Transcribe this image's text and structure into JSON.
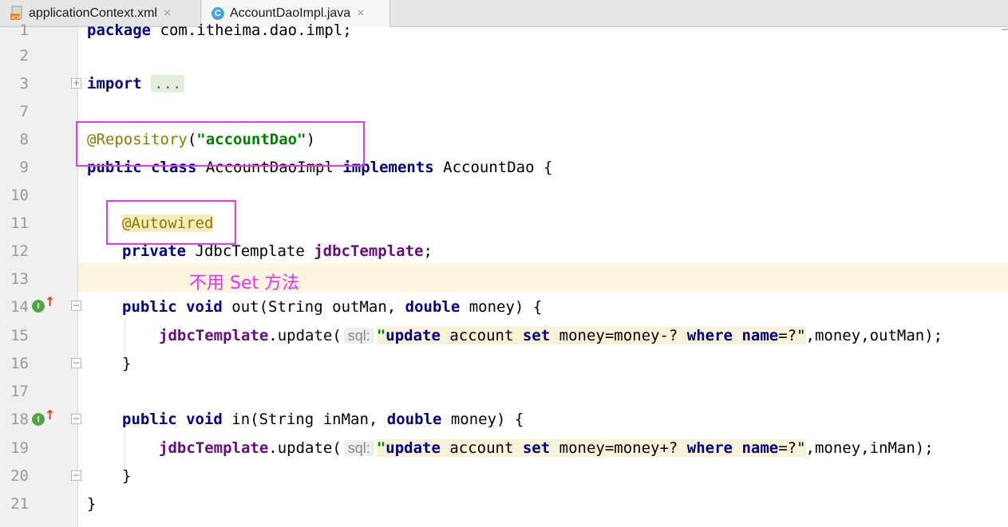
{
  "tabs": [
    {
      "label": "applicationContext.xml",
      "close": "×"
    },
    {
      "label": "AccountDaoImpl.java",
      "close": "×",
      "icon_letter": "C"
    }
  ],
  "gutter": {
    "line_numbers": [
      "1",
      "2",
      "3",
      "7",
      "8",
      "9",
      "10",
      "11",
      "12",
      "13",
      "14",
      "15",
      "16",
      "17",
      "18",
      "19",
      "20",
      "21"
    ],
    "impl_icon_letter": "I"
  },
  "code": {
    "l1_kw": "package",
    "l1_pkg": " com.itheima.dao.impl;",
    "l3_kw": "import",
    "l3_folded": "...",
    "l8_ann": "@Repository",
    "l8_open": "(",
    "l8_str": "\"accountDao\"",
    "l8_close": ")",
    "l9_kw1": "public",
    "l9_kw2": "class",
    "l9_name": " AccountDaoImpl ",
    "l9_kw3": "implements",
    "l9_rest": " AccountDao {",
    "l11_ann": "@Autowired",
    "l12_kw": "private",
    "l12_type": " JdbcTemplate ",
    "l12_field": "jdbcTemplate",
    "l12_semi": ";",
    "l14_kw1": "public",
    "l14_kw2": "void",
    "l14_sig1": " out(String outMan, ",
    "l14_kw3": "double",
    "l14_sig2": " money) {",
    "l15_field": "jdbcTemplate",
    "l15_call": ".update(",
    "l15_hint": "sql:",
    "l15_q1": "\"",
    "l15_kw_update": "update",
    "l15_txt1": " account ",
    "l15_kw_set": "set",
    "l15_txt2": " money=money-? ",
    "l15_kw_where": "where",
    "l15_kw_name": "name",
    "l15_txt3": "=?\"",
    "l15_rest": ",money,outMan);",
    "l16": "}",
    "l18_kw1": "public",
    "l18_kw2": "void",
    "l18_sig1": " in(String inMan, ",
    "l18_kw3": "double",
    "l18_sig2": " money) {",
    "l19_field": "jdbcTemplate",
    "l19_call": ".update(",
    "l19_hint": "sql:",
    "l19_q1": "\"",
    "l19_kw_update": "update",
    "l19_txt1": " account ",
    "l19_kw_set": "set",
    "l19_txt2": " money=money+? ",
    "l19_kw_where": "where",
    "l19_kw_name": "name",
    "l19_txt3": "=?\"",
    "l19_rest": ",money,inMan);",
    "l20": "}",
    "l21": "}"
  },
  "annotation_note": "不用 Set 方法",
  "colors": {
    "highlight_box": "#e83ae8",
    "note_text": "#ee2ef0",
    "keyword": "#000080",
    "annotation": "#808000",
    "string": "#008000",
    "field": "#660e7a"
  }
}
